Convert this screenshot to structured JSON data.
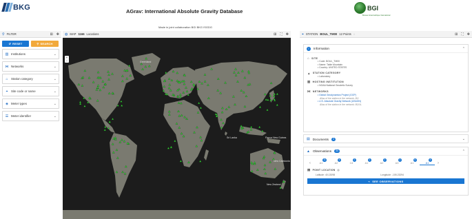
{
  "header": {
    "logo_left": "BKG",
    "title": "AGrav: International Absolute Gravity Database",
    "collab": "Made in joint collaboration BGI BKG ISGDG",
    "logo_right": "BGI",
    "logo_right_sub": "Bureau Gravimétrique International"
  },
  "filter": {
    "header_label": "FILTER",
    "reset_label": "RESET",
    "search_label": "SEARCH",
    "items": [
      {
        "label": "Institutions",
        "icon": "institution-icon"
      },
      {
        "label": "Networks",
        "icon": "network-icon"
      },
      {
        "label": "Station category",
        "icon": "home-icon"
      },
      {
        "label": "Site code or name",
        "icon": "location-icon"
      },
      {
        "label": "Meter types",
        "icon": "tag-icon"
      },
      {
        "label": "Meter identifier",
        "icon": "list-icon"
      }
    ]
  },
  "map": {
    "header_label": "MAP",
    "count": "1166",
    "count_suffix": "Locations",
    "place_labels": [
      {
        "id": "greenland",
        "text": "Greenland"
      },
      {
        "id": "sri-lanka",
        "text": "Sri Lanka"
      },
      {
        "id": "papua",
        "text": "Papua New Guinea"
      },
      {
        "id": "new-caledonia",
        "text": "New Caledonia"
      },
      {
        "id": "new-zealand",
        "text": "New Zealand"
      }
    ],
    "colors": {
      "ocean": "#1c1c1c",
      "land": "#7a7a70",
      "marker": "#39d43a"
    }
  },
  "station": {
    "header_label": "STATION",
    "code": "BOUL_TM00",
    "points": "12 Points",
    "information": {
      "title": "Information",
      "site_title": "SITE",
      "site_items": [
        "Code: BOUL_TM00",
        "Name: Table Mountain",
        "Country: UNITED STATES"
      ],
      "category_title": "STATION CATEGORY",
      "category_items": [
        "Laboratory"
      ],
      "hosting_title": "HOSTING INSTITUTION",
      "hosting_items": [
        "NOAA National Geodetic Survey"
      ],
      "networks_title": "NETWORKS",
      "network1": "Global Geodynamics Project (GGP)",
      "network1_alias": "Alias of the station in the network: BO",
      "network2": "U.S. Absolute Gravity Network (USAGN)",
      "network2_alias": "Alias of the station in the network: BOUL"
    },
    "documents": {
      "title": "Documents",
      "count": "3"
    },
    "observations": {
      "title": "Observations",
      "count": "34",
      "tabs": [
        {
          "label": "A1",
          "count": "11"
        },
        {
          "label": "A2",
          "count": "4"
        },
        {
          "label": "C4",
          "count": "2"
        },
        {
          "label": "A1",
          "count": "1"
        },
        {
          "label": "A2",
          "count": "2"
        },
        {
          "label": "A3",
          "count": "1"
        },
        {
          "label": "A1",
          "count": "6"
        },
        {
          "label": "A1",
          "count": "4"
        }
      ],
      "point_location_title": "POINT LOCATION",
      "latitude": "Latitude: 40.13098",
      "longitude": "Longitude: -105.23294",
      "see_button": "SEE OBSERVATIONS"
    }
  }
}
